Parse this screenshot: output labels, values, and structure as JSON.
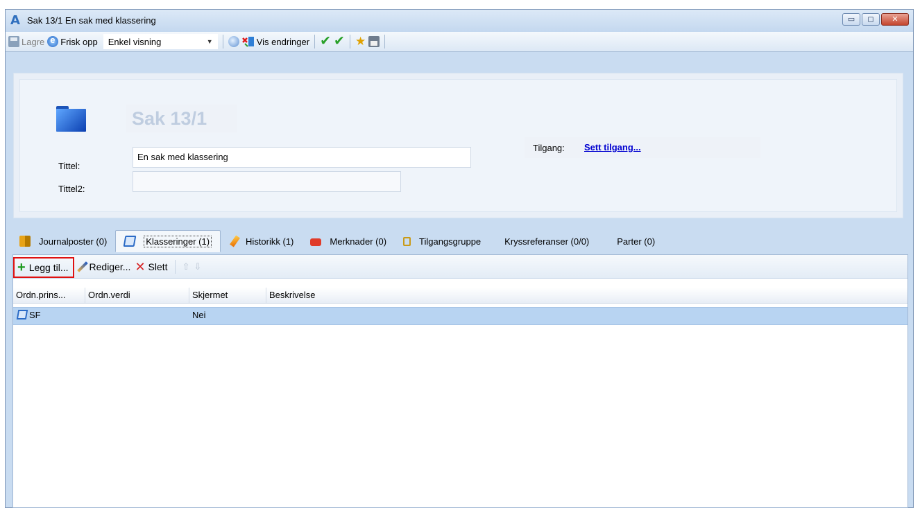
{
  "window": {
    "title": "Sak 13/1 En sak med klassering",
    "app_icon": "A",
    "buttons": {
      "minimize": "▭",
      "maximize": "◻",
      "close": "✕"
    }
  },
  "toolbar": {
    "save_label": "Lagre",
    "refresh_label": "Frisk opp",
    "view_combo": "Enkel visning",
    "changes_label": "Vis endringer"
  },
  "header": {
    "case_title": "Sak 13/1",
    "title_label": "Tittel:",
    "title_value": "En sak med klassering",
    "title2_label": "Tittel2:",
    "title2_value": "",
    "access_label": "Tilgang:",
    "access_link": "Sett tilgang..."
  },
  "tabs": [
    {
      "label": "Journalposter (0)",
      "icon": "journal-icon"
    },
    {
      "label": "Klasseringer (1)",
      "icon": "classification-icon",
      "active": true
    },
    {
      "label": "Historikk (1)",
      "icon": "history-icon"
    },
    {
      "label": "Merknader (0)",
      "icon": "notes-icon"
    },
    {
      "label": "Tilgangsgruppe",
      "icon": "access-group-icon"
    },
    {
      "label": "Kryssreferanser (0/0)",
      "icon": ""
    },
    {
      "label": "Parter (0)",
      "icon": ""
    }
  ],
  "subtoolbar": {
    "add_label": "Legg til...",
    "edit_label": "Rediger...",
    "delete_label": "Slett"
  },
  "grid": {
    "columns": [
      "Ordn.prins...",
      "Ordn.verdi",
      "Skjermet",
      "Beskrivelse"
    ],
    "rows": [
      {
        "ordn_prins": "SF",
        "ordn_verdi": "",
        "skjermet": "Nei",
        "beskrivelse": ""
      }
    ]
  },
  "colors": {
    "chrome": "#c9dcf1",
    "selected_row": "#b8d4f2",
    "link": "#0000d0",
    "highlight_border": "#e01010"
  }
}
